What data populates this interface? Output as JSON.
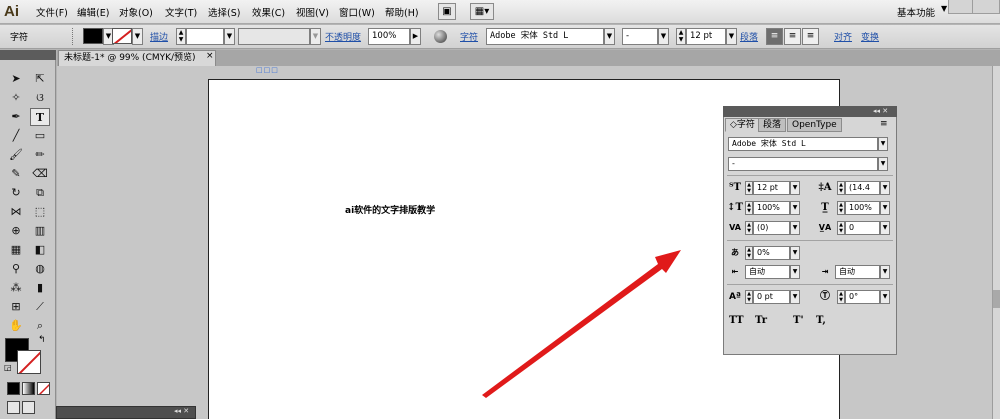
{
  "app": {
    "logo": "Ai"
  },
  "menu": {
    "items": [
      "文件(F)",
      "编辑(E)",
      "对象(O)",
      "文字(T)",
      "选择(S)",
      "效果(C)",
      "视图(V)",
      "窗口(W)",
      "帮助(H)"
    ],
    "workspace": "基本功能"
  },
  "control_bar": {
    "mode_label": "字符",
    "stroke_label": "描边",
    "opacity_label": "不透明度",
    "opacity_value": "100%",
    "char_label": "字符",
    "font_family": "Adobe 宋体 Std L",
    "font_style": "-",
    "font_size": "12 pt",
    "paragraph_label": "段落",
    "align_label": "对齐",
    "transform_label": "变换"
  },
  "document": {
    "tab_title": "未标题-1* @ 99% (CMYK/预览)",
    "tab_close": "×",
    "text": "ai软件的文字排版教学"
  },
  "char_panel": {
    "tabs": [
      "字符",
      "段落",
      "OpenType"
    ],
    "font_family": "Adobe 宋体 Std L",
    "font_style": "-",
    "font_size": "12 pt",
    "leading": "(14.4",
    "vertical_scale": "100%",
    "horizontal_scale": "100%",
    "kerning": "(0)",
    "tracking": "0",
    "tsume": "0%",
    "aki_left": "自动",
    "aki_right": "自动",
    "baseline_shift": "0 pt",
    "rotation": "0°",
    "bottom_buttons": [
      "TT",
      "Tr",
      "T'",
      "T,"
    ]
  },
  "colors": {
    "accent_link": "#1f4fa8",
    "arrow": "#e01a1a",
    "fill": "#000000",
    "none_slash": "#d42020"
  }
}
